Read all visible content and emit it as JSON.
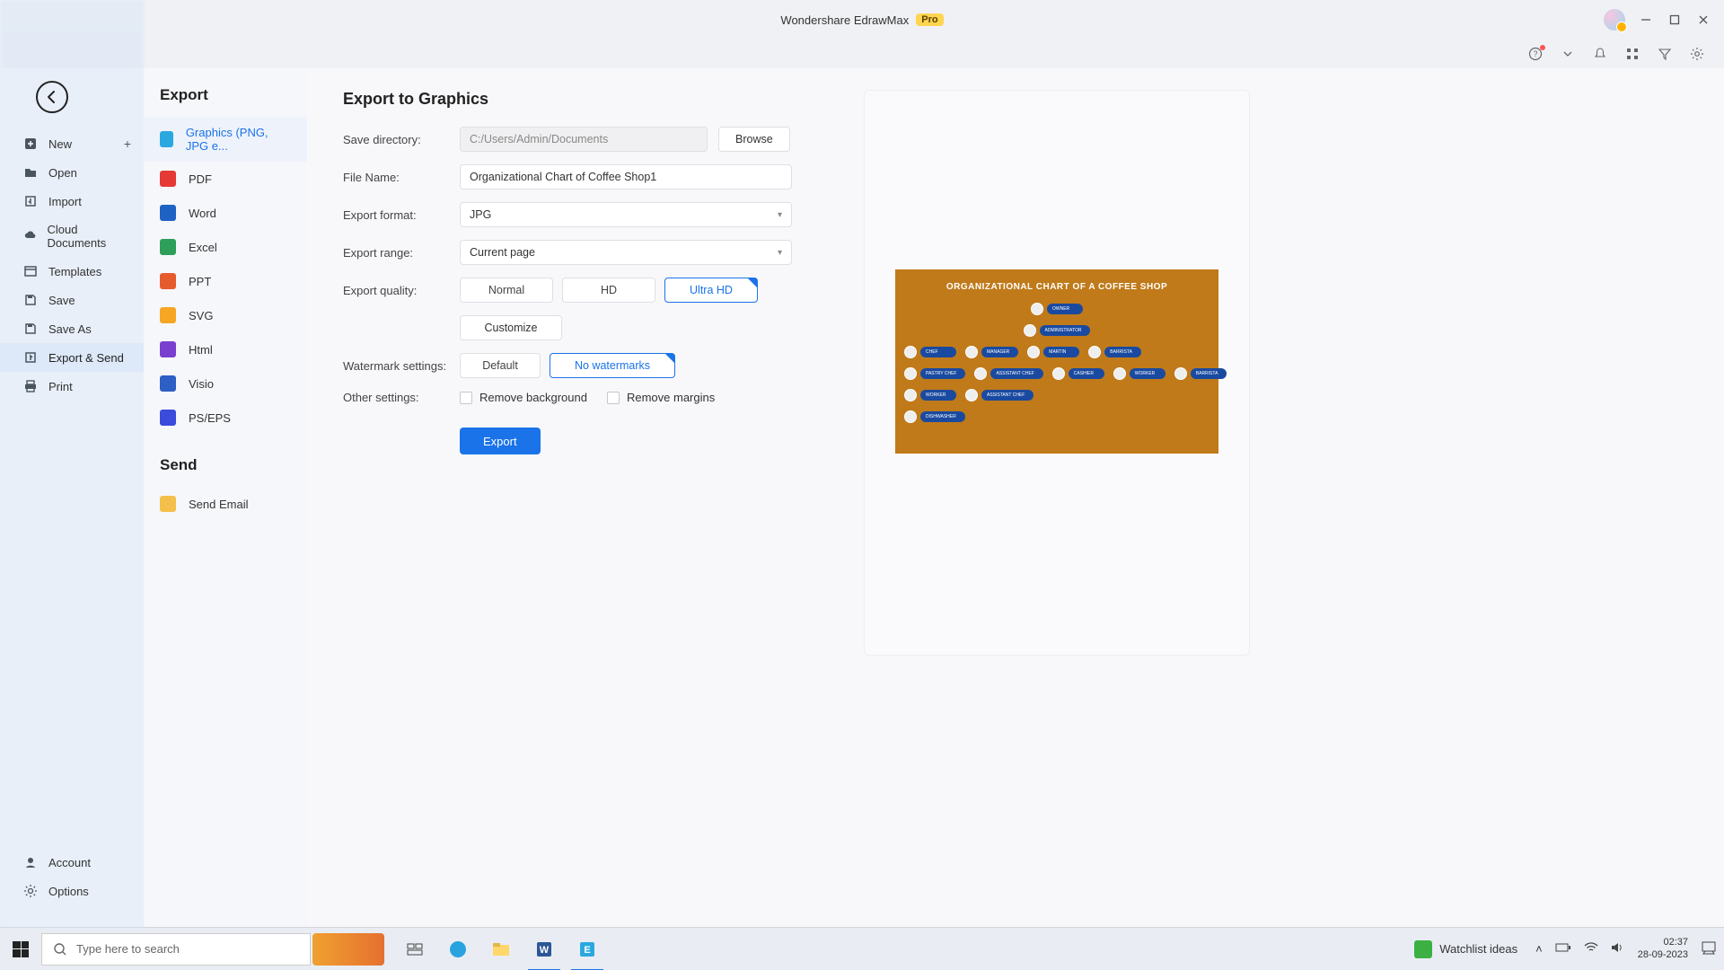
{
  "titlebar": {
    "app_name": "Wondershare EdrawMax",
    "badge": "Pro"
  },
  "file_menu": {
    "items": [
      {
        "label": "New",
        "icon": "plus-square",
        "plus": true
      },
      {
        "label": "Open",
        "icon": "folder"
      },
      {
        "label": "Import",
        "icon": "import"
      },
      {
        "label": "Cloud Documents",
        "icon": "cloud"
      },
      {
        "label": "Templates",
        "icon": "template"
      },
      {
        "label": "Save",
        "icon": "save"
      },
      {
        "label": "Save As",
        "icon": "save-as"
      },
      {
        "label": "Export & Send",
        "icon": "export",
        "active": true
      },
      {
        "label": "Print",
        "icon": "print"
      }
    ],
    "bottom": [
      {
        "label": "Account",
        "icon": "account"
      },
      {
        "label": "Options",
        "icon": "gear"
      }
    ]
  },
  "export_types": {
    "heading": "Export",
    "items": [
      {
        "label": "Graphics (PNG, JPG e...",
        "cls": "ic-gr",
        "sel": true
      },
      {
        "label": "PDF",
        "cls": "ic-pdf"
      },
      {
        "label": "Word",
        "cls": "ic-wrd"
      },
      {
        "label": "Excel",
        "cls": "ic-xls"
      },
      {
        "label": "PPT",
        "cls": "ic-ppt"
      },
      {
        "label": "SVG",
        "cls": "ic-svg"
      },
      {
        "label": "Html",
        "cls": "ic-htm"
      },
      {
        "label": "Visio",
        "cls": "ic-vis"
      },
      {
        "label": "PS/EPS",
        "cls": "ic-ps"
      }
    ],
    "send_heading": "Send",
    "send_items": [
      {
        "label": "Send Email",
        "cls": "ic-eml"
      }
    ]
  },
  "panel": {
    "title": "Export to Graphics",
    "labels": {
      "save_dir": "Save directory:",
      "file_name": "File Name:",
      "format": "Export format:",
      "range": "Export range:",
      "quality": "Export quality:",
      "watermark": "Watermark settings:",
      "other": "Other settings:"
    },
    "save_dir_value": "C:/Users/Admin/Documents",
    "browse": "Browse",
    "file_name_value": "Organizational Chart of Coffee Shop1",
    "format_value": "JPG",
    "range_value": "Current page",
    "quality_options": [
      "Normal",
      "HD",
      "Ultra HD"
    ],
    "quality_selected": "Ultra HD",
    "customize": "Customize",
    "watermark_options": [
      "Default",
      "No watermarks"
    ],
    "watermark_selected": "No watermarks",
    "other_remove_bg": "Remove background",
    "other_remove_margins": "Remove margins",
    "export_btn": "Export"
  },
  "preview": {
    "title": "ORGANIZATIONAL CHART OF A COFFEE SHOP",
    "rows": {
      "r0": [
        "OWNER"
      ],
      "r1": [
        "ADMINISTRATOR"
      ],
      "r2": [
        "CHEF",
        "MANAGER",
        "MARTIN",
        "BARRISTA"
      ],
      "r3": [
        "PASTRY CHEF",
        "ASSISTANT CHEF",
        "CASHIER",
        "WORKER",
        "BARRISTA"
      ],
      "r4": [
        "WORKER",
        "ASSISTANT CHEF"
      ],
      "r5": [
        "DISHWASHER"
      ]
    }
  },
  "taskbar": {
    "search_placeholder": "Type here to search",
    "news_label": "Watchlist ideas",
    "time": "02:37",
    "date": "28-09-2023"
  }
}
